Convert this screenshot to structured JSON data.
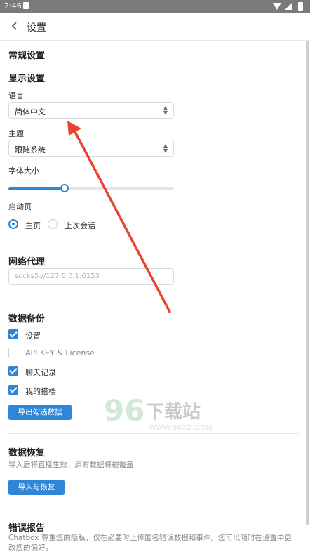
{
  "status_bar": {
    "time": "2:46",
    "left_icon": "sd-card-icon",
    "right_icons": [
      "wifi-icon",
      "signal-icon",
      "battery-icon"
    ]
  },
  "app_bar": {
    "back_icon": "chevron-left-icon",
    "title": "设置"
  },
  "general": {
    "title": "常规设置"
  },
  "display": {
    "title": "显示设置",
    "language_label": "语言",
    "language_value": "简体中文",
    "theme_label": "主题",
    "theme_value": "跟随系统",
    "font_size_label": "字体大小",
    "font_size_level": 0.34,
    "startup_label": "启动页",
    "startup_options": [
      "主页",
      "上次会话"
    ],
    "startup_selected": "主页"
  },
  "proxy": {
    "title": "网络代理",
    "placeholder": "socks5://127.0.0.1:6153"
  },
  "backup": {
    "title": "数据备份",
    "items": [
      {
        "label": "设置",
        "checked": true
      },
      {
        "label": "API KEY & License",
        "checked": false
      },
      {
        "label": "聊天记录",
        "checked": true
      },
      {
        "label": "我的搭档",
        "checked": true
      }
    ],
    "export_button": "导出勾选数据"
  },
  "restore": {
    "title": "数据恢复",
    "hint": "导入后将直接生效，原有数据将被覆盖",
    "import_button": "导入与恢复"
  },
  "error_report": {
    "title": "错误报告",
    "text": "Chatbox 尊重您的隐私，仅在必要时上传匿名错误数据和事件。您可以随时在设置中更改您的偏好。"
  },
  "watermark": {
    "digits": "96",
    "name": "下载站",
    "url": "WWW.96XZ.COM"
  },
  "colors": {
    "accent": "#2f86d8",
    "annotation_arrow": "#e8442f",
    "status_bar": "#7a7a7a"
  }
}
